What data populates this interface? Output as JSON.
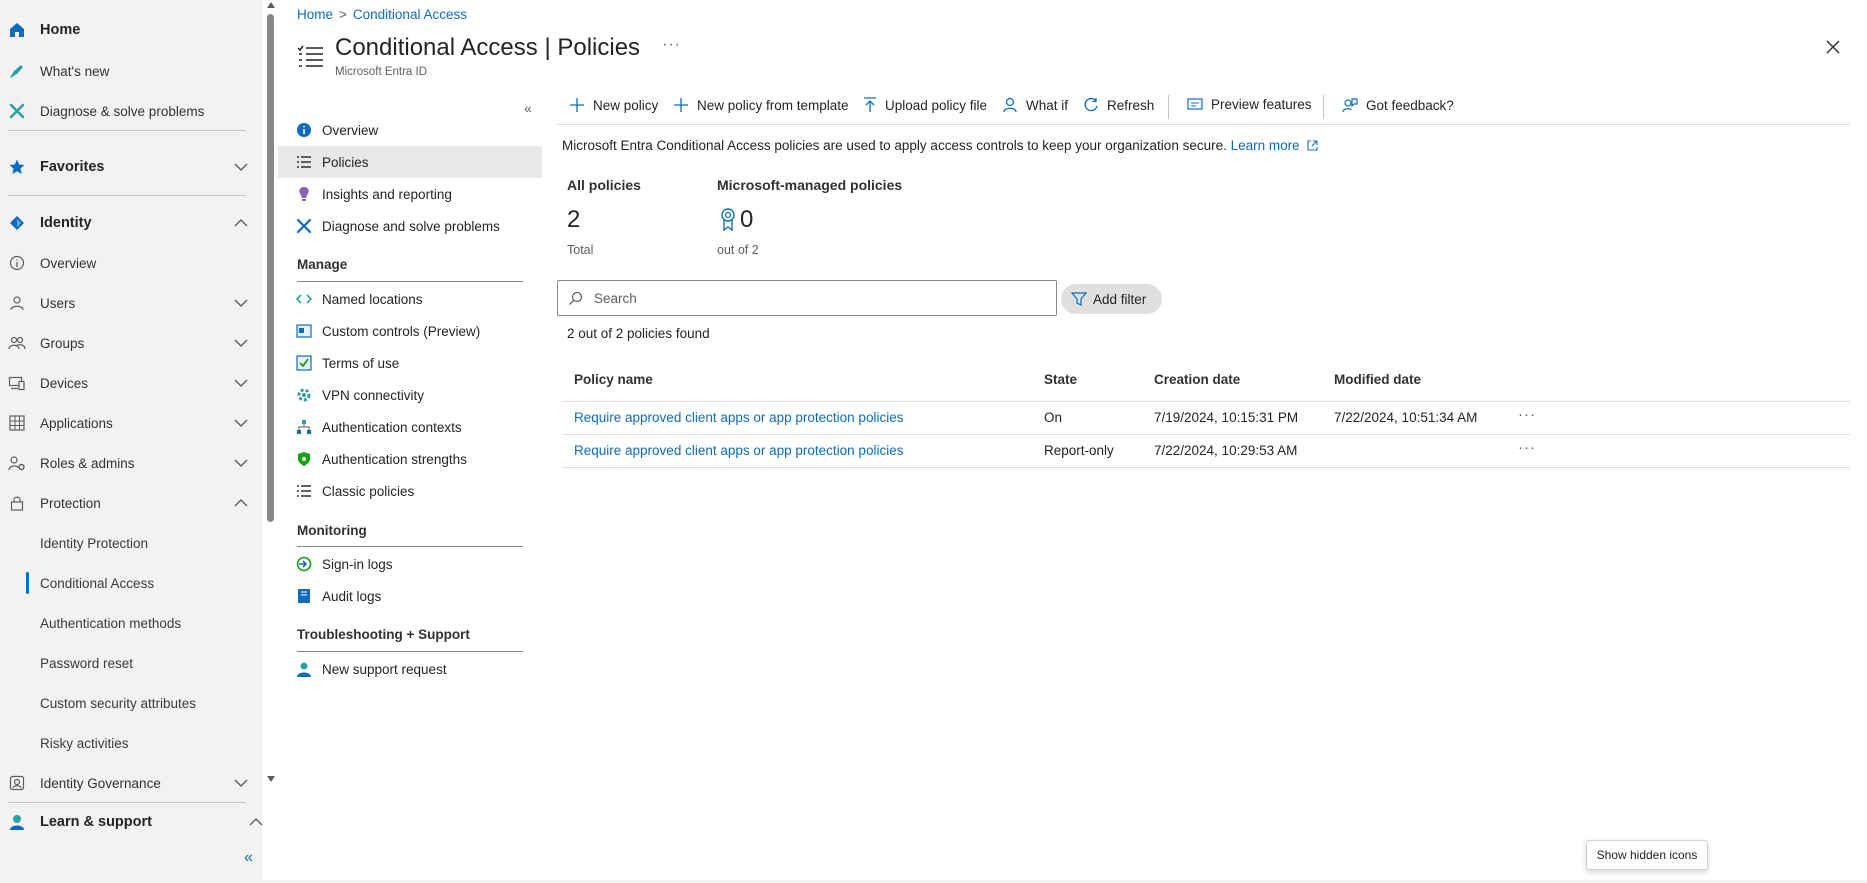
{
  "left_nav": {
    "home": "Home",
    "whats_new": "What's new",
    "diagnose": "Diagnose & solve problems",
    "favorites": "Favorites",
    "identity": "Identity",
    "overview": "Overview",
    "users": "Users",
    "groups": "Groups",
    "devices": "Devices",
    "applications": "Applications",
    "roles_admins": "Roles & admins",
    "protection": "Protection",
    "identity_protection": "Identity Protection",
    "conditional_access": "Conditional Access",
    "authentication_methods": "Authentication methods",
    "password_reset": "Password reset",
    "custom_security_attributes": "Custom security attributes",
    "risky_activities": "Risky activities",
    "identity_governance": "Identity Governance",
    "learn_support": "Learn & support",
    "collapse": "«"
  },
  "breadcrumb": {
    "home": "Home",
    "separator": ">",
    "current": "Conditional Access"
  },
  "page": {
    "title": "Conditional Access | Policies",
    "subtitle": "Microsoft Entra ID",
    "more": "···"
  },
  "menu": {
    "collapse": "«",
    "overview": "Overview",
    "policies": "Policies",
    "insights": "Insights and reporting",
    "diagnose": "Diagnose and solve problems",
    "manage_header": "Manage",
    "named_locations": "Named locations",
    "custom_controls": "Custom controls (Preview)",
    "terms_of_use": "Terms of use",
    "vpn": "VPN connectivity",
    "auth_contexts": "Authentication contexts",
    "auth_strengths": "Authentication strengths",
    "classic_policies": "Classic policies",
    "monitoring_header": "Monitoring",
    "signin_logs": "Sign-in logs",
    "audit_logs": "Audit logs",
    "troubleshooting_header": "Troubleshooting + Support",
    "new_support": "New support request"
  },
  "toolbar": {
    "new_policy": "New policy",
    "new_from_template": "New policy from template",
    "upload": "Upload policy file",
    "what_if": "What if",
    "refresh": "Refresh",
    "preview_features": "Preview features",
    "feedback": "Got feedback?"
  },
  "info": {
    "text": "Microsoft Entra Conditional Access policies are used to apply access controls to keep your organization secure.",
    "learn_more": "Learn more"
  },
  "stats": {
    "all_label": "All policies",
    "all_value": "2",
    "all_sub": "Total",
    "managed_label": "Microsoft-managed policies",
    "managed_value": "0",
    "managed_sub": "out of 2"
  },
  "search": {
    "placeholder": "Search"
  },
  "filter": {
    "label": "Add filter"
  },
  "results": {
    "count_text": "2 out of 2 policies found"
  },
  "table": {
    "columns": [
      "Policy name",
      "State",
      "Creation date",
      "Modified date"
    ],
    "rows": [
      {
        "name": "Require approved client apps or app protection policies",
        "state": "On",
        "created": "7/19/2024, 10:15:31 PM",
        "modified": "7/22/2024, 10:51:34 AM",
        "more": "···"
      },
      {
        "name": "Require approved client apps or app protection policies",
        "state": "Report-only",
        "created": "7/22/2024, 10:29:53 AM",
        "modified": "",
        "more": "···"
      }
    ]
  },
  "tooltip": {
    "text": "Show hidden icons"
  },
  "colors": {
    "accent": "#0f6cbd",
    "nav_bg": "#f2f2f2"
  }
}
